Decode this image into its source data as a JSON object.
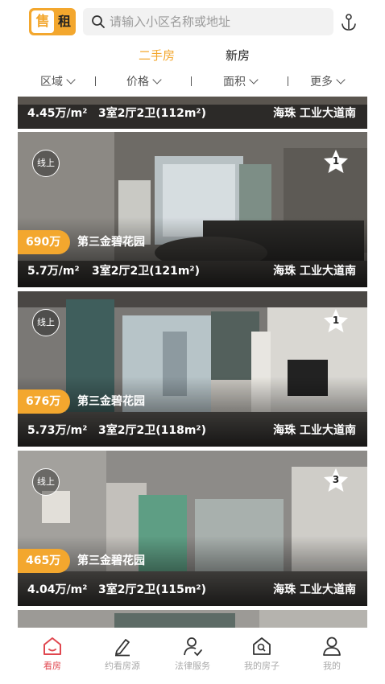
{
  "header": {
    "toggle": {
      "sell": "售",
      "rent": "租"
    },
    "search_placeholder": "请输入小区名称或地址",
    "location_icon": "anchor-pin-icon"
  },
  "segment": {
    "active": "二手房",
    "inactive": "新房"
  },
  "filters": [
    "区域",
    "价格",
    "面积",
    "更多"
  ],
  "listings": [
    {
      "unit_price": "4.45万/m²",
      "layout": "3室2厅2卫(112m²)",
      "location": "海珠 工业大道南"
    },
    {
      "online_badge": "线上",
      "favorites": "1",
      "price": "690万",
      "community": "第三金碧花园",
      "unit_price": "5.7万/m²",
      "layout": "3室2厅2卫(121m²)",
      "location": "海珠 工业大道南"
    },
    {
      "online_badge": "线上",
      "favorites": "1",
      "price": "676万",
      "community": "第三金碧花园",
      "unit_price": "5.73万/m²",
      "layout": "3室2厅2卫(118m²)",
      "location": "海珠 工业大道南"
    },
    {
      "online_badge": "线上",
      "favorites": "3",
      "price": "465万",
      "community": "第三金碧花园",
      "unit_price": "4.04万/m²",
      "layout": "3室2厅2卫(115m²)",
      "location": "海珠 工业大道南"
    }
  ],
  "bottom_nav": [
    {
      "label": "看房",
      "icon": "house-icon",
      "active": true
    },
    {
      "label": "约看房源",
      "icon": "pen-icon",
      "active": false
    },
    {
      "label": "法律服务",
      "icon": "person-check-icon",
      "active": false
    },
    {
      "label": "我的房子",
      "icon": "house-search-icon",
      "active": false
    },
    {
      "label": "我的",
      "icon": "user-icon",
      "active": false
    }
  ],
  "colors": {
    "accent": "#f3a72e",
    "nav_active": "#e0474f"
  }
}
